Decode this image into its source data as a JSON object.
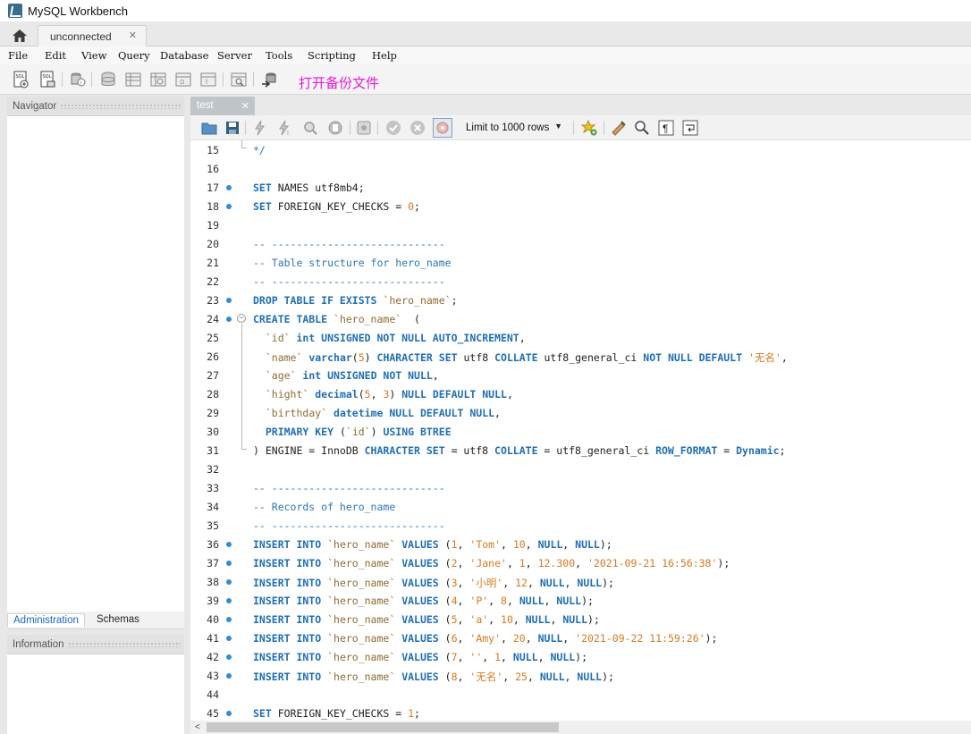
{
  "window": {
    "title": "MySQL Workbench"
  },
  "connection_tab": {
    "label": "unconnected",
    "close": "✕"
  },
  "menu": [
    "File",
    "Edit",
    "View",
    "Query",
    "Database",
    "Server",
    "Tools",
    "Scripting",
    "Help"
  ],
  "toolbar": {
    "annotation": "打开备份文件",
    "icons": [
      "new-sql-tab-icon",
      "open-sql-file-icon",
      "inspector-icon",
      "create-schema-icon",
      "create-table-icon",
      "create-view-icon",
      "create-procedure-icon",
      "create-function-icon",
      "search-table-data-icon",
      "reconnect-icon"
    ]
  },
  "sidebar": {
    "navigator_title": "Navigator",
    "tabs": [
      "Administration",
      "Schemas"
    ],
    "information_title": "Information"
  },
  "editor": {
    "tab_label": "test",
    "tab_close": "✕",
    "limit_select": "Limit to 1000 rows",
    "sql_toolbar_icons": [
      "open-file-icon",
      "save-icon",
      "execute-icon",
      "execute-current-icon",
      "explain-icon",
      "stop-icon",
      "toggle-autocommit-icon",
      "commit-icon",
      "rollback-icon",
      "toggle-output-icon",
      "add-snippet-icon",
      "beautify-icon",
      "find-icon",
      "invisible-chars-icon",
      "wrap-icon"
    ]
  },
  "code_lines": [
    {
      "n": "15",
      "tokens": [
        {
          "t": "*/",
          "c": "cm"
        }
      ]
    },
    {
      "n": "16",
      "tokens": []
    },
    {
      "n": "17",
      "dot": true,
      "tokens": [
        {
          "t": "SET",
          "c": "kw"
        },
        {
          "t": " NAMES utf8mb4;",
          "c": "plain"
        }
      ]
    },
    {
      "n": "18",
      "dot": true,
      "tokens": [
        {
          "t": "SET",
          "c": "kw"
        },
        {
          "t": " FOREIGN_KEY_CHECKS = ",
          "c": "plain"
        },
        {
          "t": "0",
          "c": "num"
        },
        {
          "t": ";",
          "c": "plain"
        }
      ]
    },
    {
      "n": "19",
      "tokens": []
    },
    {
      "n": "20",
      "tokens": [
        {
          "t": "-- ----------------------------",
          "c": "cm"
        }
      ]
    },
    {
      "n": "21",
      "tokens": [
        {
          "t": "-- Table structure for hero_name",
          "c": "cm"
        }
      ]
    },
    {
      "n": "22",
      "tokens": [
        {
          "t": "-- ----------------------------",
          "c": "cm"
        }
      ]
    },
    {
      "n": "23",
      "dot": true,
      "tokens": [
        {
          "t": "DROP TABLE IF EXISTS ",
          "c": "kw"
        },
        {
          "t": "`hero_name`",
          "c": "ident"
        },
        {
          "t": ";",
          "c": "plain"
        }
      ]
    },
    {
      "n": "24",
      "dot": true,
      "fold": true,
      "tokens": [
        {
          "t": "CREATE TABLE ",
          "c": "kw"
        },
        {
          "t": "`hero_name`",
          "c": "ident"
        },
        {
          "t": "  (",
          "c": "plain"
        }
      ]
    },
    {
      "n": "25",
      "tokens": [
        {
          "t": "  ",
          "c": "plain"
        },
        {
          "t": "`id`",
          "c": "ident"
        },
        {
          "t": " int UNSIGNED NOT NULL AUTO_INCREMENT",
          "c": "kw"
        },
        {
          "t": ",",
          "c": "plain"
        }
      ]
    },
    {
      "n": "26",
      "tokens": [
        {
          "t": "  ",
          "c": "plain"
        },
        {
          "t": "`name`",
          "c": "ident"
        },
        {
          "t": " varchar",
          "c": "kw"
        },
        {
          "t": "(",
          "c": "plain"
        },
        {
          "t": "5",
          "c": "num"
        },
        {
          "t": ") ",
          "c": "plain"
        },
        {
          "t": "CHARACTER SET",
          "c": "kw"
        },
        {
          "t": " utf8 ",
          "c": "plain"
        },
        {
          "t": "COLLATE",
          "c": "kw"
        },
        {
          "t": " utf8_general_ci ",
          "c": "plain"
        },
        {
          "t": "NOT NULL DEFAULT ",
          "c": "kw"
        },
        {
          "t": "'无名'",
          "c": "str"
        },
        {
          "t": ",",
          "c": "plain"
        }
      ]
    },
    {
      "n": "27",
      "tokens": [
        {
          "t": "  ",
          "c": "plain"
        },
        {
          "t": "`age`",
          "c": "ident"
        },
        {
          "t": " int UNSIGNED NOT NULL",
          "c": "kw"
        },
        {
          "t": ",",
          "c": "plain"
        }
      ]
    },
    {
      "n": "28",
      "tokens": [
        {
          "t": "  ",
          "c": "plain"
        },
        {
          "t": "`hight`",
          "c": "ident"
        },
        {
          "t": " decimal",
          "c": "kw"
        },
        {
          "t": "(",
          "c": "plain"
        },
        {
          "t": "5",
          "c": "num"
        },
        {
          "t": ", ",
          "c": "plain"
        },
        {
          "t": "3",
          "c": "num"
        },
        {
          "t": ") ",
          "c": "plain"
        },
        {
          "t": "NULL DEFAULT NULL",
          "c": "kw"
        },
        {
          "t": ",",
          "c": "plain"
        }
      ]
    },
    {
      "n": "29",
      "tokens": [
        {
          "t": "  ",
          "c": "plain"
        },
        {
          "t": "`birthday`",
          "c": "ident"
        },
        {
          "t": " datetime NULL DEFAULT NULL",
          "c": "kw"
        },
        {
          "t": ",",
          "c": "plain"
        }
      ]
    },
    {
      "n": "30",
      "tokens": [
        {
          "t": "  ",
          "c": "plain"
        },
        {
          "t": "PRIMARY KEY",
          "c": "kw"
        },
        {
          "t": " (",
          "c": "plain"
        },
        {
          "t": "`id`",
          "c": "ident"
        },
        {
          "t": ") ",
          "c": "plain"
        },
        {
          "t": "USING BTREE",
          "c": "kw"
        }
      ]
    },
    {
      "n": "31",
      "foldend": true,
      "tokens": [
        {
          "t": ") ENGINE = InnoDB ",
          "c": "plain"
        },
        {
          "t": "CHARACTER SET",
          "c": "kw"
        },
        {
          "t": " = utf8 ",
          "c": "plain"
        },
        {
          "t": "COLLATE",
          "c": "kw"
        },
        {
          "t": " = utf8_general_ci ",
          "c": "plain"
        },
        {
          "t": "ROW_FORMAT",
          "c": "kw"
        },
        {
          "t": " = ",
          "c": "plain"
        },
        {
          "t": "Dynamic",
          "c": "kw"
        },
        {
          "t": ";",
          "c": "plain"
        }
      ]
    },
    {
      "n": "32",
      "tokens": []
    },
    {
      "n": "33",
      "tokens": [
        {
          "t": "-- ----------------------------",
          "c": "cm"
        }
      ]
    },
    {
      "n": "34",
      "tokens": [
        {
          "t": "-- Records of hero_name",
          "c": "cm"
        }
      ]
    },
    {
      "n": "35",
      "tokens": [
        {
          "t": "-- ----------------------------",
          "c": "cm"
        }
      ]
    },
    {
      "n": "36",
      "dot": true,
      "tokens": [
        {
          "t": "INSERT INTO ",
          "c": "kw"
        },
        {
          "t": "`hero_name`",
          "c": "ident"
        },
        {
          "t": " VALUES",
          "c": "kw"
        },
        {
          "t": " (",
          "c": "plain"
        },
        {
          "t": "1",
          "c": "num"
        },
        {
          "t": ", ",
          "c": "plain"
        },
        {
          "t": "'Tom'",
          "c": "str"
        },
        {
          "t": ", ",
          "c": "plain"
        },
        {
          "t": "10",
          "c": "num"
        },
        {
          "t": ", ",
          "c": "plain"
        },
        {
          "t": "NULL",
          "c": "kw"
        },
        {
          "t": ", ",
          "c": "plain"
        },
        {
          "t": "NULL",
          "c": "kw"
        },
        {
          "t": ");",
          "c": "plain"
        }
      ]
    },
    {
      "n": "37",
      "dot": true,
      "tokens": [
        {
          "t": "INSERT INTO ",
          "c": "kw"
        },
        {
          "t": "`hero_name`",
          "c": "ident"
        },
        {
          "t": " VALUES",
          "c": "kw"
        },
        {
          "t": " (",
          "c": "plain"
        },
        {
          "t": "2",
          "c": "num"
        },
        {
          "t": ", ",
          "c": "plain"
        },
        {
          "t": "'Jane'",
          "c": "str"
        },
        {
          "t": ", ",
          "c": "plain"
        },
        {
          "t": "1",
          "c": "num"
        },
        {
          "t": ", ",
          "c": "plain"
        },
        {
          "t": "12.300",
          "c": "num"
        },
        {
          "t": ", ",
          "c": "plain"
        },
        {
          "t": "'2021-09-21 16:56:38'",
          "c": "str"
        },
        {
          "t": ");",
          "c": "plain"
        }
      ]
    },
    {
      "n": "38",
      "dot": true,
      "tokens": [
        {
          "t": "INSERT INTO ",
          "c": "kw"
        },
        {
          "t": "`hero_name`",
          "c": "ident"
        },
        {
          "t": " VALUES",
          "c": "kw"
        },
        {
          "t": " (",
          "c": "plain"
        },
        {
          "t": "3",
          "c": "num"
        },
        {
          "t": ", ",
          "c": "plain"
        },
        {
          "t": "'小明'",
          "c": "str"
        },
        {
          "t": ", ",
          "c": "plain"
        },
        {
          "t": "12",
          "c": "num"
        },
        {
          "t": ", ",
          "c": "plain"
        },
        {
          "t": "NULL",
          "c": "kw"
        },
        {
          "t": ", ",
          "c": "plain"
        },
        {
          "t": "NULL",
          "c": "kw"
        },
        {
          "t": ");",
          "c": "plain"
        }
      ]
    },
    {
      "n": "39",
      "dot": true,
      "tokens": [
        {
          "t": "INSERT INTO ",
          "c": "kw"
        },
        {
          "t": "`hero_name`",
          "c": "ident"
        },
        {
          "t": " VALUES",
          "c": "kw"
        },
        {
          "t": " (",
          "c": "plain"
        },
        {
          "t": "4",
          "c": "num"
        },
        {
          "t": ", ",
          "c": "plain"
        },
        {
          "t": "'P'",
          "c": "str"
        },
        {
          "t": ", ",
          "c": "plain"
        },
        {
          "t": "8",
          "c": "num"
        },
        {
          "t": ", ",
          "c": "plain"
        },
        {
          "t": "NULL",
          "c": "kw"
        },
        {
          "t": ", ",
          "c": "plain"
        },
        {
          "t": "NULL",
          "c": "kw"
        },
        {
          "t": ");",
          "c": "plain"
        }
      ]
    },
    {
      "n": "40",
      "dot": true,
      "tokens": [
        {
          "t": "INSERT INTO ",
          "c": "kw"
        },
        {
          "t": "`hero_name`",
          "c": "ident"
        },
        {
          "t": " VALUES",
          "c": "kw"
        },
        {
          "t": " (",
          "c": "plain"
        },
        {
          "t": "5",
          "c": "num"
        },
        {
          "t": ", ",
          "c": "plain"
        },
        {
          "t": "'a'",
          "c": "str"
        },
        {
          "t": ", ",
          "c": "plain"
        },
        {
          "t": "10",
          "c": "num"
        },
        {
          "t": ", ",
          "c": "plain"
        },
        {
          "t": "NULL",
          "c": "kw"
        },
        {
          "t": ", ",
          "c": "plain"
        },
        {
          "t": "NULL",
          "c": "kw"
        },
        {
          "t": ");",
          "c": "plain"
        }
      ]
    },
    {
      "n": "41",
      "dot": true,
      "tokens": [
        {
          "t": "INSERT INTO ",
          "c": "kw"
        },
        {
          "t": "`hero_name`",
          "c": "ident"
        },
        {
          "t": " VALUES",
          "c": "kw"
        },
        {
          "t": " (",
          "c": "plain"
        },
        {
          "t": "6",
          "c": "num"
        },
        {
          "t": ", ",
          "c": "plain"
        },
        {
          "t": "'Amy'",
          "c": "str"
        },
        {
          "t": ", ",
          "c": "plain"
        },
        {
          "t": "20",
          "c": "num"
        },
        {
          "t": ", ",
          "c": "plain"
        },
        {
          "t": "NULL",
          "c": "kw"
        },
        {
          "t": ", ",
          "c": "plain"
        },
        {
          "t": "'2021-09-22 11:59:26'",
          "c": "str"
        },
        {
          "t": ");",
          "c": "plain"
        }
      ]
    },
    {
      "n": "42",
      "dot": true,
      "tokens": [
        {
          "t": "INSERT INTO ",
          "c": "kw"
        },
        {
          "t": "`hero_name`",
          "c": "ident"
        },
        {
          "t": " VALUES",
          "c": "kw"
        },
        {
          "t": " (",
          "c": "plain"
        },
        {
          "t": "7",
          "c": "num"
        },
        {
          "t": ", ",
          "c": "plain"
        },
        {
          "t": "''",
          "c": "str"
        },
        {
          "t": ", ",
          "c": "plain"
        },
        {
          "t": "1",
          "c": "num"
        },
        {
          "t": ", ",
          "c": "plain"
        },
        {
          "t": "NULL",
          "c": "kw"
        },
        {
          "t": ", ",
          "c": "plain"
        },
        {
          "t": "NULL",
          "c": "kw"
        },
        {
          "t": ");",
          "c": "plain"
        }
      ]
    },
    {
      "n": "43",
      "dot": true,
      "tokens": [
        {
          "t": "INSERT INTO ",
          "c": "kw"
        },
        {
          "t": "`hero_name`",
          "c": "ident"
        },
        {
          "t": " VALUES",
          "c": "kw"
        },
        {
          "t": " (",
          "c": "plain"
        },
        {
          "t": "8",
          "c": "num"
        },
        {
          "t": ", ",
          "c": "plain"
        },
        {
          "t": "'无名'",
          "c": "str"
        },
        {
          "t": ", ",
          "c": "plain"
        },
        {
          "t": "25",
          "c": "num"
        },
        {
          "t": ", ",
          "c": "plain"
        },
        {
          "t": "NULL",
          "c": "kw"
        },
        {
          "t": ", ",
          "c": "plain"
        },
        {
          "t": "NULL",
          "c": "kw"
        },
        {
          "t": ");",
          "c": "plain"
        }
      ]
    },
    {
      "n": "44",
      "tokens": []
    },
    {
      "n": "45",
      "dot": true,
      "tokens": [
        {
          "t": "SET",
          "c": "kw"
        },
        {
          "t": " FOREIGN_KEY_CHECKS = ",
          "c": "plain"
        },
        {
          "t": "1",
          "c": "num"
        },
        {
          "t": ";",
          "c": "plain"
        }
      ]
    }
  ]
}
